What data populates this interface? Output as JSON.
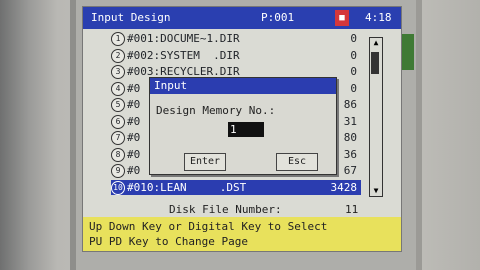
{
  "titlebar": {
    "title": "Input Design",
    "page": "P:001",
    "time": "4:18",
    "icon": "red-square-icon"
  },
  "files": [
    {
      "index": "1",
      "name": "#001:DOCUME~1.DIR",
      "size": "0"
    },
    {
      "index": "2",
      "name": "#002:SYSTEM  .DIR",
      "size": "0"
    },
    {
      "index": "3",
      "name": "#003:RECYCLER.DIR",
      "size": "0"
    },
    {
      "index": "4",
      "name": "#0",
      "size": "0"
    },
    {
      "index": "5",
      "name": "#0",
      "size": "86"
    },
    {
      "index": "6",
      "name": "#0",
      "size": "31"
    },
    {
      "index": "7",
      "name": "#0",
      "size": "80"
    },
    {
      "index": "8",
      "name": "#0",
      "size": "36"
    },
    {
      "index": "9",
      "name": "#0",
      "size": "67"
    },
    {
      "index": "10",
      "name": "#010:LEAN     .DST",
      "size": "3428",
      "selected": true
    }
  ],
  "dialog": {
    "title": "Input",
    "label": "Design Memory No.:",
    "value": "1",
    "enter_label": "Enter",
    "esc_label": "Esc"
  },
  "disk_info": {
    "label": "Disk File Number:",
    "value": "11"
  },
  "hint": {
    "line1": "Up Down Key or Digital  Key to Select",
    "line2": "PU PD Key to Change Page"
  },
  "colors": {
    "titlebar": "#2a3fb0",
    "hint_bg": "#e8e15c",
    "selection": "#2b3db0"
  }
}
